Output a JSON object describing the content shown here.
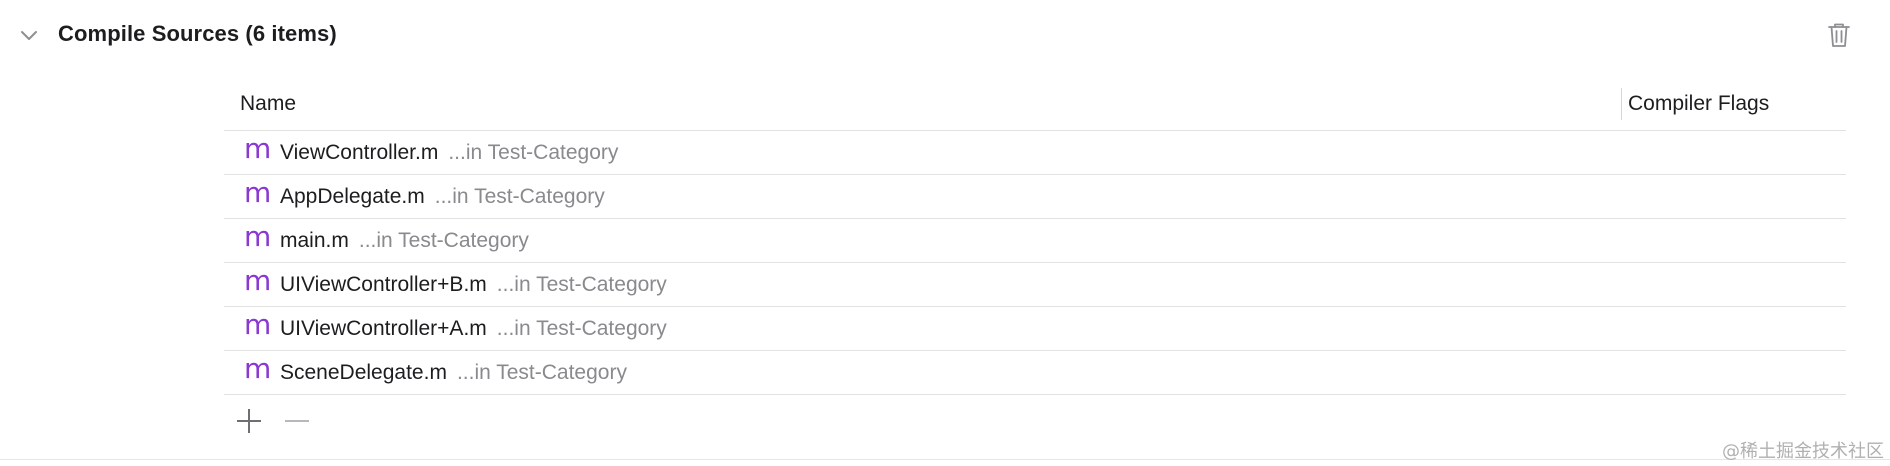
{
  "section": {
    "title": "Compile Sources (6 items)"
  },
  "table": {
    "columns": {
      "name": "Name",
      "flags": "Compiler Flags"
    },
    "rows": [
      {
        "icon": "m",
        "name": "ViewController.m",
        "location": "...in Test-Category"
      },
      {
        "icon": "m",
        "name": "AppDelegate.m",
        "location": "...in Test-Category"
      },
      {
        "icon": "m",
        "name": "main.m",
        "location": "...in Test-Category"
      },
      {
        "icon": "m",
        "name": "UIViewController+B.m",
        "location": "...in Test-Category"
      },
      {
        "icon": "m",
        "name": "UIViewController+A.m",
        "location": "...in Test-Category"
      },
      {
        "icon": "m",
        "name": "SceneDelegate.m",
        "location": "...in Test-Category"
      }
    ]
  },
  "icons": {
    "disclosure": "chevron-down-icon",
    "delete": "trash-icon",
    "add": "plus-icon",
    "remove": "minus-icon",
    "file": "objc-source-file-icon"
  },
  "colors": {
    "file_icon": "#8a3ad0",
    "secondary_text": "#8a8a8e",
    "divider": "#e2e2e2"
  },
  "watermark": "@稀土掘金技术社区"
}
